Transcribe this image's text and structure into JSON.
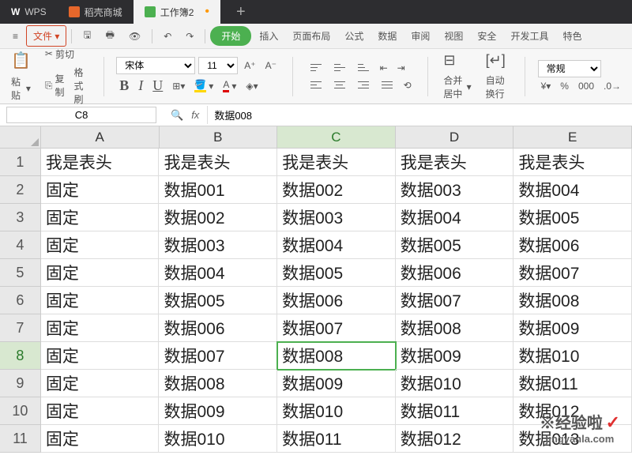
{
  "tabs": {
    "wps": "WPS",
    "doc": "稻壳商城",
    "xls": "工作簿2"
  },
  "menu": {
    "file": "文件",
    "start": "开始",
    "insert": "插入",
    "layout": "页面布局",
    "formula": "公式",
    "data": "数据",
    "review": "审阅",
    "view": "视图",
    "security": "安全",
    "dev": "开发工具",
    "spec": "特色"
  },
  "tool": {
    "cut": "剪切",
    "paste": "粘贴",
    "copy": "复制",
    "format": "格式刷",
    "font_name": "宋体",
    "font_size": "11",
    "merge": "合并居中",
    "wrap": "自动换行",
    "numfmt": "常规"
  },
  "cellref": "C8",
  "formula": "数据008",
  "headers": [
    "A",
    "B",
    "C",
    "D",
    "E"
  ],
  "rows": [
    [
      "我是表头",
      "我是表头",
      "我是表头",
      "我是表头",
      "我是表头"
    ],
    [
      "固定",
      "数据001",
      "数据002",
      "数据003",
      "数据004"
    ],
    [
      "固定",
      "数据002",
      "数据003",
      "数据004",
      "数据005"
    ],
    [
      "固定",
      "数据003",
      "数据004",
      "数据005",
      "数据006"
    ],
    [
      "固定",
      "数据004",
      "数据005",
      "数据006",
      "数据007"
    ],
    [
      "固定",
      "数据005",
      "数据006",
      "数据007",
      "数据008"
    ],
    [
      "固定",
      "数据006",
      "数据007",
      "数据008",
      "数据009"
    ],
    [
      "固定",
      "数据007",
      "数据008",
      "数据009",
      "数据010"
    ],
    [
      "固定",
      "数据008",
      "数据009",
      "数据010",
      "数据011"
    ],
    [
      "固定",
      "数据009",
      "数据010",
      "数据011",
      "数据012"
    ],
    [
      "固定",
      "数据010",
      "数据011",
      "数据012",
      "数据013"
    ]
  ],
  "active": {
    "row": 8,
    "col": 3
  },
  "watermark": {
    "brand": "经验啦",
    "url": "jingyanla.com"
  }
}
